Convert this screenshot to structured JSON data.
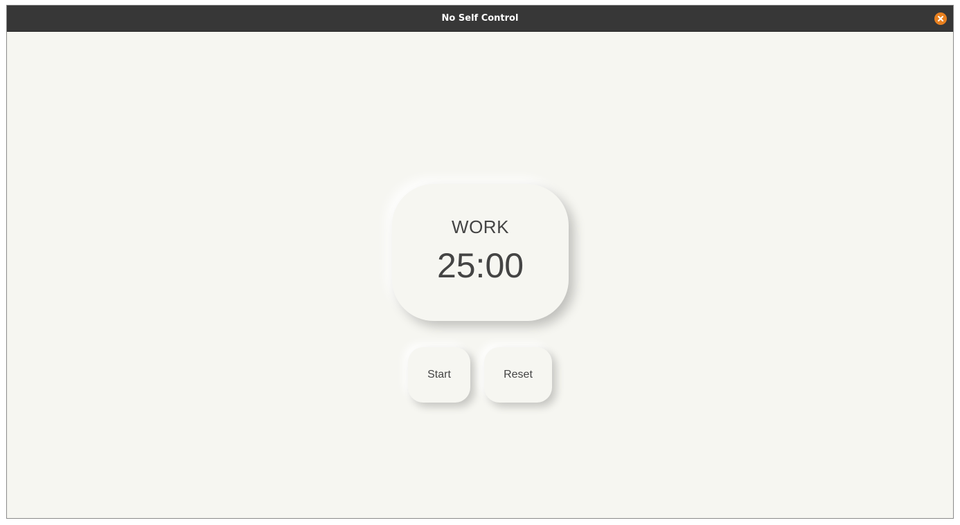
{
  "window": {
    "title": "No Self Control"
  },
  "timer": {
    "mode": "WORK",
    "time": "25:00"
  },
  "controls": {
    "start_label": "Start",
    "reset_label": "Reset"
  },
  "colors": {
    "titlebar": "#373737",
    "close_button": "#e8801f",
    "background": "#f6f6f1",
    "text": "#444444"
  },
  "icons": {
    "close": "close-icon"
  }
}
